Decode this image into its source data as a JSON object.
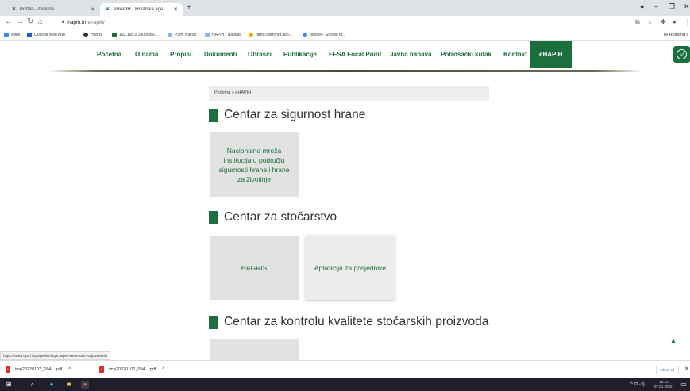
{
  "browser": {
    "tabs": [
      {
        "title": "Portal - Početna",
        "favicon": "leaf-icon"
      },
      {
        "title": "eHAPIH - Hrvatska agencija za p",
        "favicon": "leaf-icon"
      }
    ],
    "url_host": "hapih.hr",
    "url_path": "/ehapih/",
    "bookmarks": [
      {
        "label": "Apps",
        "color": "#4285f4"
      },
      {
        "label": "Outlook Web App",
        "color": "#0a64c8"
      },
      {
        "label": "Hagris",
        "color": "#333333"
      },
      {
        "label": "192.168.0.140:8080...",
        "color": "#1a6f3d"
      },
      {
        "label": "Putni Nalozi",
        "color": "#8ab4f8"
      },
      {
        "label": "HAPIH - Naplata",
        "color": "#8ab4f8"
      },
      {
        "label": "https://agronet.app...",
        "color": "#f9ab00"
      },
      {
        "label": "google - Google pr...",
        "color": "#4285f4"
      }
    ],
    "reading_list": "Reading li"
  },
  "site_nav": {
    "items": [
      {
        "label": "Početna"
      },
      {
        "label": "O nama"
      },
      {
        "label": "Propisi"
      },
      {
        "label": "Dokumenti"
      },
      {
        "label": "Obrasci"
      },
      {
        "label": "Publikacije"
      },
      {
        "label": "EFSA Focal Point"
      },
      {
        "label": "Javna nabava"
      },
      {
        "label": "Potrošački kutak"
      },
      {
        "label": "Kontakt"
      },
      {
        "label": "eHAPIH"
      }
    ],
    "active_index": 10,
    "accent": "#1a6f3d"
  },
  "breadcrumb": "Početna » eHAPIH",
  "sections": [
    {
      "title": "Centar za sigurnost hrane",
      "cards": [
        {
          "label": "Nacionalna mreža institucija u području sigurnosti hrane i hrane za životinje"
        }
      ]
    },
    {
      "title": "Centar za stočarstvo",
      "cards": [
        {
          "label": "HAGRIS"
        },
        {
          "label": "Aplikacija za posjednike"
        }
      ]
    },
    {
      "title": "Centar za kontrolu kvalitete stočarskih proizvoda",
      "cards": [
        {
          "label": ""
        }
      ]
    }
  ],
  "status_url": "https://stoka.hpa.hr/posjednik/login.aspx?ReturnUrl=%2fposjednik",
  "downloads": [
    {
      "file": "img20220107_094....pdf"
    },
    {
      "file": "img20220107_094....pdf"
    }
  ],
  "show_all": "Show all",
  "clock": {
    "time": "10:21",
    "date": "07.01.2022."
  }
}
